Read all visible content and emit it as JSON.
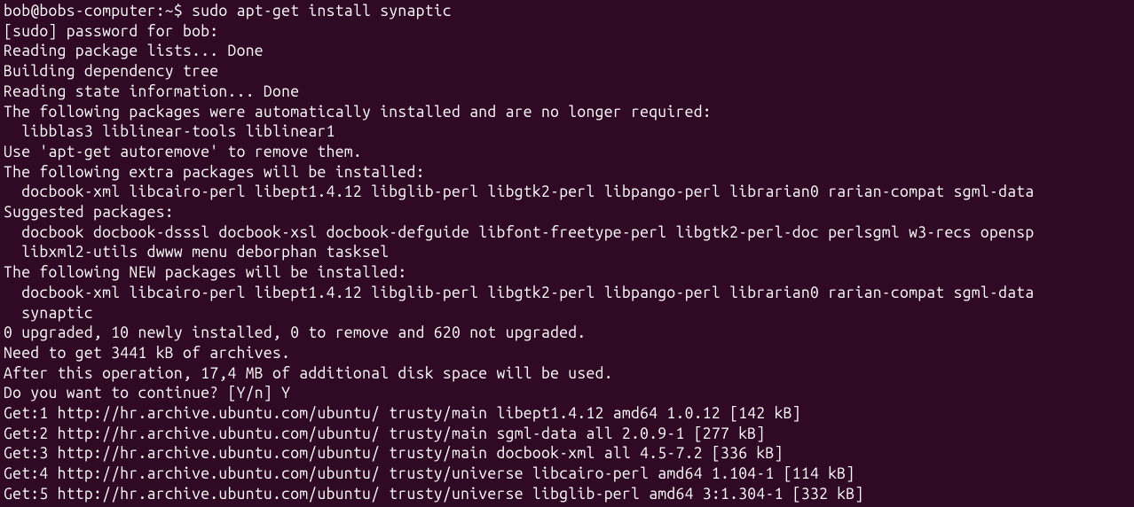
{
  "terminal": {
    "lines": [
      {
        "text": "bob@bobs-computer:~$ sudo apt-get install synaptic"
      },
      {
        "text": "[sudo] password for bob:"
      },
      {
        "text": "Reading package lists... Done"
      },
      {
        "text": "Building dependency tree"
      },
      {
        "text": "Reading state information... Done"
      },
      {
        "text": "The following packages were automatically installed and are no longer required:"
      },
      {
        "text": "  libblas3 liblinear-tools liblinear1"
      },
      {
        "text": "Use 'apt-get autoremove' to remove them."
      },
      {
        "text": "The following extra packages will be installed:"
      },
      {
        "text": "  docbook-xml libcairo-perl libept1.4.12 libglib-perl libgtk2-perl libpango-perl librarian0 rarian-compat sgml-data"
      },
      {
        "text": "Suggested packages:"
      },
      {
        "text": "  docbook docbook-dsssl docbook-xsl docbook-defguide libfont-freetype-perl libgtk2-perl-doc perlsgml w3-recs opensp"
      },
      {
        "text": "  libxml2-utils dwww menu deborphan tasksel"
      },
      {
        "text": "The following NEW packages will be installed:"
      },
      {
        "text": "  docbook-xml libcairo-perl libept1.4.12 libglib-perl libgtk2-perl libpango-perl librarian0 rarian-compat sgml-data"
      },
      {
        "text": "  synaptic"
      },
      {
        "text": "0 upgraded, 10 newly installed, 0 to remove and 620 not upgraded."
      },
      {
        "text": "Need to get 3441 kB of archives."
      },
      {
        "text": "After this operation, 17,4 MB of additional disk space will be used."
      },
      {
        "text": "Do you want to continue? [Y/n] Y"
      },
      {
        "text": "Get:1 http://hr.archive.ubuntu.com/ubuntu/ trusty/main libept1.4.12 amd64 1.0.12 [142 kB]"
      },
      {
        "text": "Get:2 http://hr.archive.ubuntu.com/ubuntu/ trusty/main sgml-data all 2.0.9-1 [277 kB]"
      },
      {
        "text": "Get:3 http://hr.archive.ubuntu.com/ubuntu/ trusty/main docbook-xml all 4.5-7.2 [336 kB]"
      },
      {
        "text": "Get:4 http://hr.archive.ubuntu.com/ubuntu/ trusty/universe libcairo-perl amd64 1.104-1 [114 kB]"
      },
      {
        "text": "Get:5 http://hr.archive.ubuntu.com/ubuntu/ trusty/universe libglib-perl amd64 3:1.304-1 [332 kB]"
      }
    ]
  }
}
